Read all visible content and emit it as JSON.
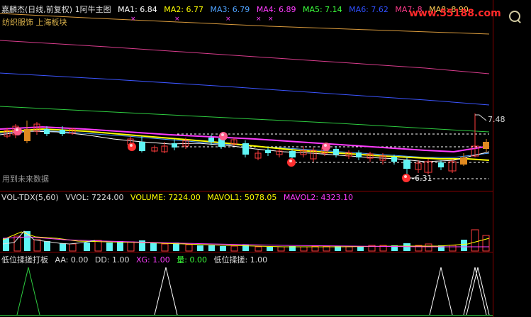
{
  "main_header": {
    "title": "嘉麟杰(日线,前复权) 1阿牛主图",
    "ma": [
      {
        "label": "MA1: 6.84",
        "color": "#ffffff"
      },
      {
        "label": "MA2: 6.77",
        "color": "#ffff00"
      },
      {
        "label": "MA3: 6.79",
        "color": "#4fa3ff"
      },
      {
        "label": "MA4: 6.89",
        "color": "#ff3cff"
      },
      {
        "label": "MA5: 7.14",
        "color": "#3cff3c"
      },
      {
        "label": "MA6: 7.62",
        "color": "#3050ff"
      },
      {
        "label": "MA7: 8",
        "color": "#ff3c8c"
      },
      {
        "label": "MA8: 8.90",
        "color": "#ffcc55"
      }
    ]
  },
  "watermark": "www.55188.com",
  "sector_text": "纺织服饰 上海板块",
  "future_text": "用到未来数据",
  "price_high_label": "7.48",
  "price_low_label": "6.31",
  "vol_header": {
    "items": [
      {
        "label": "VOL-TDX(5,60)",
        "color": "#dcdcdc"
      },
      {
        "label": "VVOL: 7224.00",
        "color": "#dcdcdc"
      },
      {
        "label": "VOLUME: 7224.00",
        "color": "#ffff00"
      },
      {
        "label": "MAVOL1: 5078.05",
        "color": "#ffff00"
      },
      {
        "label": "MAVOL2: 4323.10",
        "color": "#ff3cff"
      }
    ]
  },
  "ind_header": {
    "items": [
      {
        "label": "低位揉搓打板",
        "color": "#dcdcdc"
      },
      {
        "label": "AA: 0.00",
        "color": "#dcdcdc"
      },
      {
        "label": "DD: 1.00",
        "color": "#dcdcdc"
      },
      {
        "label": "XG: 1.00",
        "color": "#ff3cff"
      },
      {
        "label": "量: 0.00",
        "color": "#3cff3c"
      },
      {
        "label": "低位揉搓: 1.00",
        "color": "#dcdcdc"
      }
    ]
  }
}
